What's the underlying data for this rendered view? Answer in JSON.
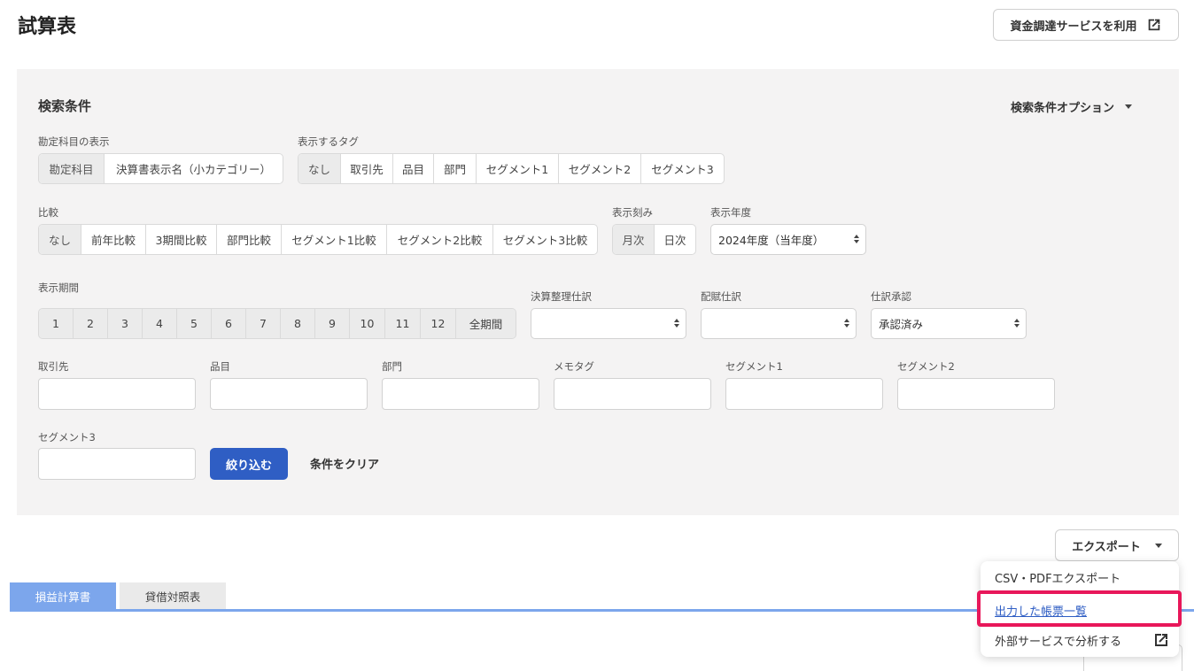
{
  "page": {
    "title": "試算表"
  },
  "funding_button": {
    "label": "資金調達サービスを利用",
    "icon": "external-link-icon"
  },
  "search": {
    "title": "検索条件",
    "options_label": "検索条件オプション",
    "account_display": {
      "label": "勘定科目の表示",
      "options": [
        "勘定科目",
        "決算書表示名（小カテゴリー）"
      ],
      "selected": 0
    },
    "tags": {
      "label": "表示するタグ",
      "options": [
        "なし",
        "取引先",
        "品目",
        "部門",
        "セグメント1",
        "セグメント2",
        "セグメント3"
      ],
      "selected": 0
    },
    "compare": {
      "label": "比較",
      "options": [
        "なし",
        "前年比較",
        "3期間比較",
        "部門比較",
        "セグメント1比較",
        "セグメント2比較",
        "セグメント3比較"
      ],
      "selected": 0
    },
    "granularity": {
      "label": "表示刻み",
      "options": [
        "月次",
        "日次"
      ],
      "selected": 0
    },
    "fiscal_year": {
      "label": "表示年度",
      "value": "2024年度（当年度）"
    },
    "period": {
      "label": "表示期間",
      "options": [
        "1",
        "2",
        "3",
        "4",
        "5",
        "6",
        "7",
        "8",
        "9",
        "10",
        "11",
        "12",
        "全期間"
      ]
    },
    "closing_entries": {
      "label": "決算整理仕訳",
      "value": ""
    },
    "allocation_entries": {
      "label": "配賦仕訳",
      "value": ""
    },
    "approval": {
      "label": "仕訳承認",
      "value": "承認済み"
    },
    "fields": {
      "partner": "取引先",
      "item": "品目",
      "department": "部門",
      "memo_tag": "メモタグ",
      "segment1": "セグメント1",
      "segment2": "セグメント2",
      "segment3": "セグメント3"
    },
    "filter_button": "絞り込む",
    "clear_button": "条件をクリア"
  },
  "export": {
    "button": "エクスポート",
    "menu": [
      "CSV・PDFエクスポート",
      "出力した帳票一覧",
      "外部サービスで分析する"
    ]
  },
  "tabs": [
    "損益計算書",
    "貸借対照表"
  ],
  "colors": {
    "primary": "#2f5ec4",
    "tab_active": "#7ca6ec",
    "highlight": "#e8175a"
  }
}
